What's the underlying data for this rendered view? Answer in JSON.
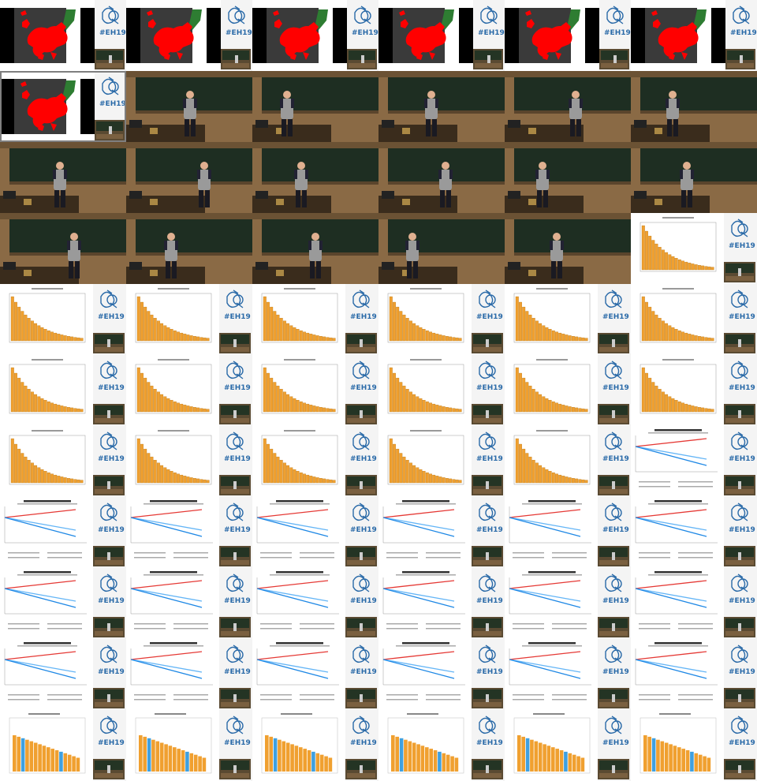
{
  "sheet": {
    "columns": 6,
    "rows": 11,
    "event_tag": "#EH19",
    "tiles": [
      "map",
      "map",
      "map",
      "map",
      "map",
      "map",
      "map",
      "lecture",
      "lecture",
      "lecture",
      "lecture",
      "lecture",
      "lecture",
      "lecture",
      "lecture",
      "lecture",
      "lecture",
      "lecture",
      "lecture",
      "lecture",
      "lecture",
      "lecture",
      "lecture",
      "bars",
      "bars",
      "bars",
      "bars",
      "bars",
      "bars",
      "bars",
      "bars",
      "bars",
      "bars",
      "bars",
      "bars",
      "bars",
      "bars",
      "bars",
      "bars",
      "bars",
      "bars",
      "lines",
      "lines",
      "lines",
      "lines",
      "lines",
      "lines",
      "lines",
      "lines",
      "lines",
      "lines",
      "lines",
      "lines",
      "lines",
      "lines",
      "lines",
      "lines",
      "lines",
      "lines",
      "lines",
      "ranked",
      "ranked",
      "ranked",
      "ranked",
      "ranked",
      "ranked"
    ],
    "selected_index": 6
  },
  "colors": {
    "map_land": "#ff0000",
    "map_other": "#2e7d32",
    "map_sea": "#3a3a3a",
    "bar_orange": "#f0a030",
    "bar_blue": "#3fa0e0",
    "line_red": "#e53935",
    "line_blue": "#1e88e5",
    "line_lightblue": "#64b5f6",
    "logo_blue": "#2a6aa8"
  }
}
